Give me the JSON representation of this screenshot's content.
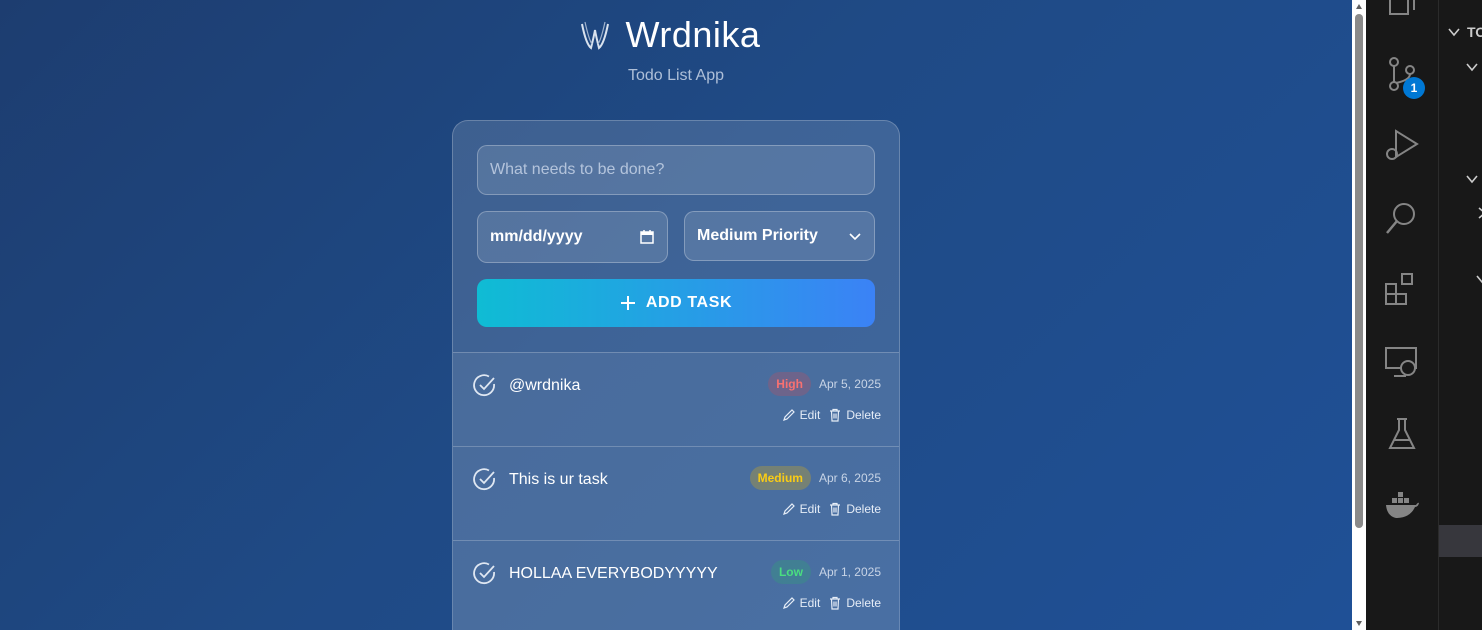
{
  "app": {
    "title": "Wrdnika",
    "subtitle": "Todo List App"
  },
  "form": {
    "task_placeholder": "What needs to be done?",
    "date_placeholder": "mm/dd/yyyy",
    "priority_selected": "Medium Priority",
    "add_button_label": "ADD TASK"
  },
  "tasks": [
    {
      "text": "@wrdnika",
      "priority": "High",
      "date": "Apr 5, 2025",
      "edit": "Edit",
      "delete": "Delete"
    },
    {
      "text": "This is ur task",
      "priority": "Medium",
      "date": "Apr 6, 2025",
      "edit": "Edit",
      "delete": "Delete"
    },
    {
      "text": "HOLLAA EVERYBODYYYYY",
      "priority": "Low",
      "date": "Apr 1, 2025",
      "edit": "Edit",
      "delete": "Delete"
    }
  ],
  "editor": {
    "source_control_badge": "1",
    "panel_header": "TO"
  },
  "colors": {
    "accent_start": "#0fbcd4",
    "accent_end": "#3b82f6",
    "high": "#f87171",
    "medium": "#facc15",
    "low": "#4ade80",
    "vscode_badge": "#0078d4"
  }
}
